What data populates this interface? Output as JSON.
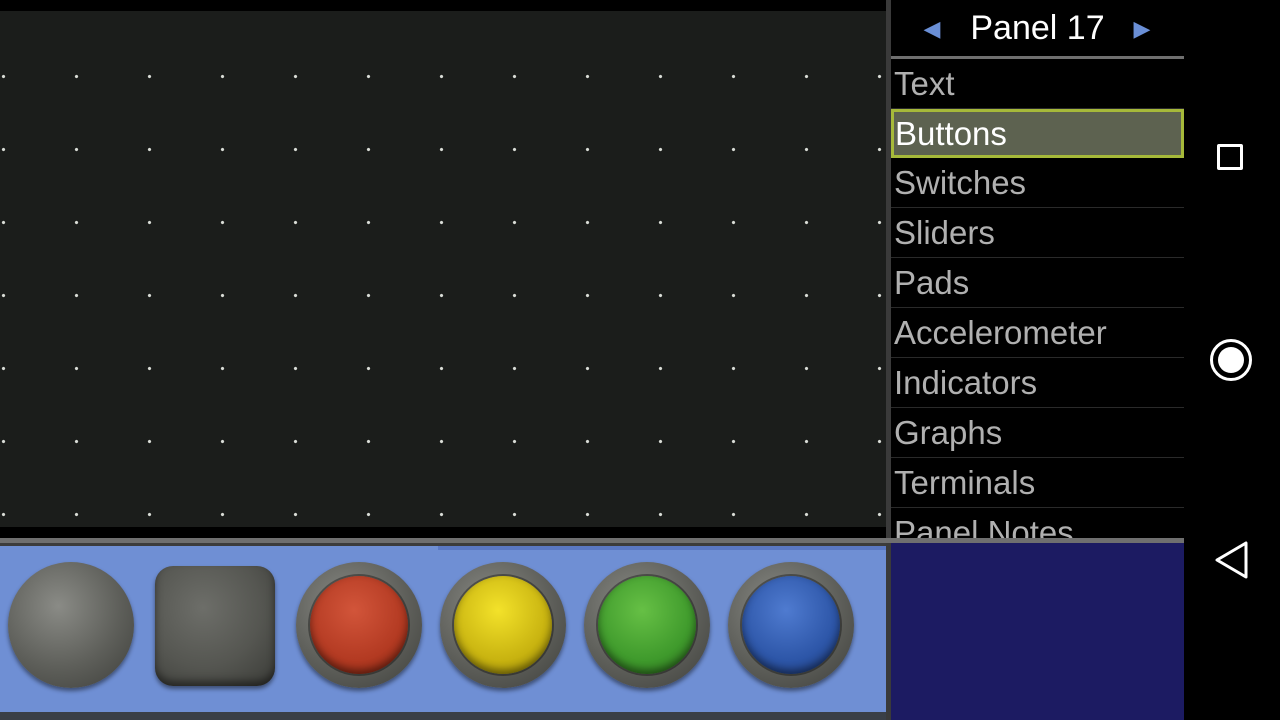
{
  "panel": {
    "title": "Panel 17",
    "prev_icon": "triangle-left-icon",
    "next_icon": "triangle-right-icon"
  },
  "categories": [
    {
      "label": "Text",
      "selected": false
    },
    {
      "label": "Buttons",
      "selected": true
    },
    {
      "label": "Switches",
      "selected": false
    },
    {
      "label": "Sliders",
      "selected": false
    },
    {
      "label": "Pads",
      "selected": false
    },
    {
      "label": "Accelerometer",
      "selected": false
    },
    {
      "label": "Indicators",
      "selected": false
    },
    {
      "label": "Graphs",
      "selected": false
    },
    {
      "label": "Terminals",
      "selected": false
    },
    {
      "label": "Panel Notes",
      "selected": false
    }
  ],
  "palette": {
    "buttons": [
      "gray-round-button",
      "gray-square-button",
      "red-button",
      "yellow-button",
      "green-button",
      "blue-button"
    ]
  },
  "colors": {
    "canvas_bg": "#1b1d1b",
    "selection_border": "#a6b93a",
    "selection_bg": "#5d6250",
    "tray_bg": "#6f8fd4",
    "preview_bg": "#1c1b62",
    "arrow": "#6a8fd6"
  },
  "nav": {
    "recents_icon": "square-icon",
    "home_icon": "circle-icon",
    "back_icon": "triangle-back-icon"
  }
}
